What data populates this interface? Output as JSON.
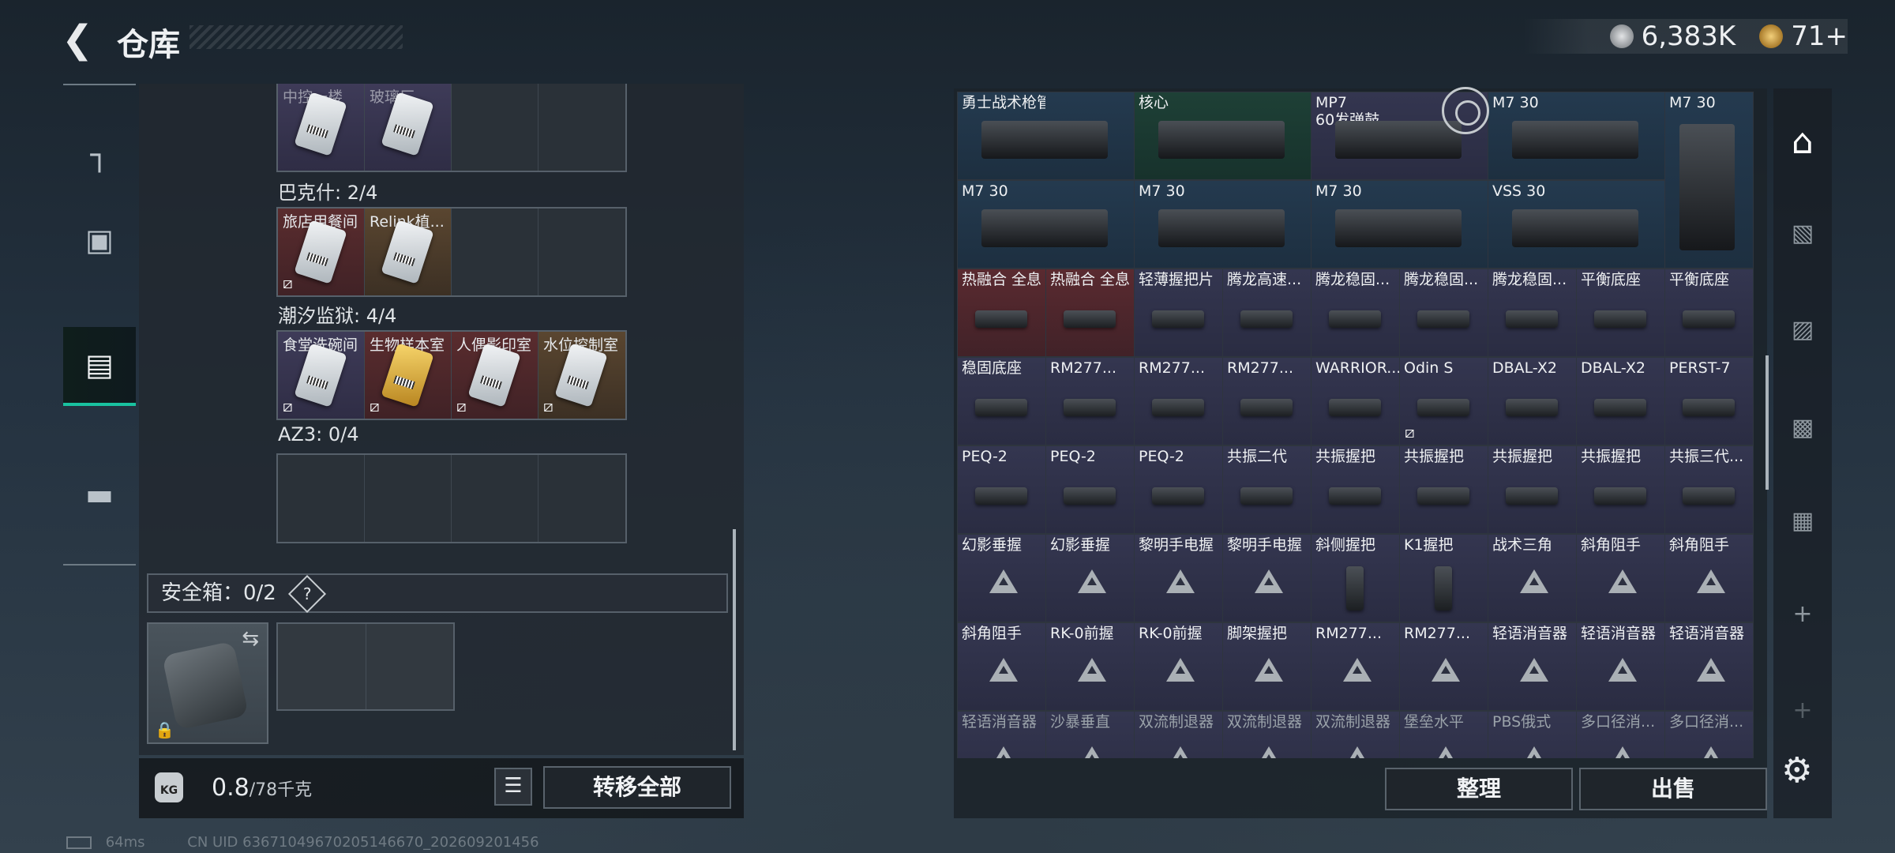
{
  "header": {
    "title": "仓库",
    "back_icon": "back-arrow-icon",
    "currency_silver": "6,383K",
    "currency_gold": "71+"
  },
  "left_nav": {
    "items": [
      {
        "name": "weapons",
        "icon": "pistol-icon"
      },
      {
        "name": "armor",
        "icon": "armor-icon"
      },
      {
        "name": "containers",
        "icon": "backpack-icon",
        "active": true
      },
      {
        "name": "toolbox",
        "icon": "toolbox-icon"
      }
    ]
  },
  "stash": {
    "top_cells": [
      "中控一楼",
      "玻璃厂"
    ],
    "groups": [
      {
        "label": "巴克什: 2/4",
        "cells": [
          "旅店用餐间",
          "Relink植..."
        ]
      },
      {
        "label": "潮汐监狱: 4/4",
        "cells": [
          "食堂洗碗间",
          "生物样本室",
          "人偶影印室",
          "水位控制室"
        ]
      },
      {
        "label": "AZ3: 0/4",
        "cells": []
      }
    ],
    "safe_label": "安全箱：0/2",
    "safe_help": "?",
    "weight_value": "0.8",
    "weight_cap": "/78千克",
    "weight_icon_text": "KG",
    "transfer_all": "转移全部"
  },
  "inventory": {
    "rows": [
      [
        "勇士战术枪管",
        "核心",
        "MP7\n60发弹鼓",
        "M7 30",
        "M7 30"
      ],
      [
        "M7 30",
        "M7 30",
        "M7 30",
        "VSS 30"
      ],
      [
        "热融合 全息",
        "热融合 全息",
        "轻薄握把片",
        "腾龙高速...",
        "腾龙稳固...",
        "腾龙稳固...",
        "腾龙稳固...",
        "平衡底座",
        "平衡底座"
      ],
      [
        "稳固底座",
        "RM277...",
        "RM277...",
        "RM277...",
        "WARRIOR...",
        "Odin S",
        "DBAL-X2",
        "DBAL-X2",
        "PERST-7"
      ],
      [
        "PEQ-2",
        "PEQ-2",
        "PEQ-2",
        "共振二代",
        "共振握把",
        "共振握把",
        "共振握把",
        "共振握把",
        "共振三代..."
      ],
      [
        "幻影垂握",
        "幻影垂握",
        "黎明手电握",
        "黎明手电握",
        "斜侧握把",
        "K1握把",
        "战术三角",
        "斜角阻手",
        "斜角阻手"
      ],
      [
        "斜角阻手",
        "RK-0前握",
        "RK-0前握",
        "脚架握把",
        "RM277...",
        "RM277...",
        "轻语消音器",
        "轻语消音器",
        "轻语消音器"
      ],
      [
        "轻语消音器",
        "沙暴垂直",
        "双流制退器",
        "双流制退器",
        "双流制退器",
        "堡垒水平",
        "PBS俄式",
        "多口径消...",
        "多口径消..."
      ]
    ],
    "sort_label": "整理",
    "sell_label": "出售"
  },
  "right_tabs": [
    {
      "name": "all",
      "icon": "stash-all-icon",
      "active": true
    },
    {
      "name": "IV",
      "icon": "tab-iv-icon"
    },
    {
      "name": "V",
      "icon": "tab-v-icon"
    },
    {
      "name": "III",
      "icon": "tab-iii-icon"
    },
    {
      "name": "II",
      "icon": "tab-ii-icon"
    },
    {
      "name": "add",
      "icon": "plus-icon"
    },
    {
      "name": "add2",
      "icon": "plus-icon"
    }
  ],
  "status": {
    "ping": "64ms",
    "uid": "CN UID 636710496702051466​70_202609201456"
  }
}
